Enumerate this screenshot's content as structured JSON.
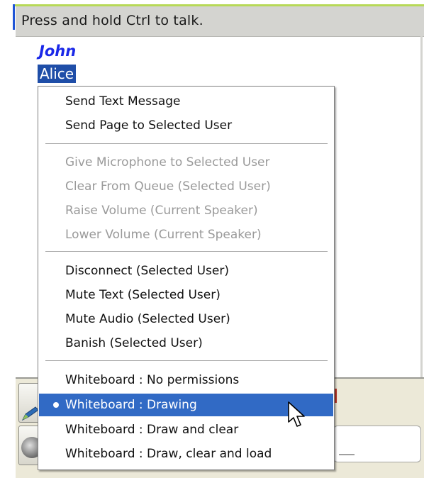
{
  "header": {
    "hint": "Press and hold Ctrl to talk."
  },
  "users": [
    {
      "name": "John",
      "style": "bold-italic-blue"
    },
    {
      "name": "Alice",
      "selected": true
    }
  ],
  "context_menu": {
    "groups": [
      [
        {
          "label": "Send Text Message",
          "enabled": true
        },
        {
          "label": "Send Page to Selected User",
          "enabled": true
        }
      ],
      [
        {
          "label": "Give Microphone to Selected User",
          "enabled": false
        },
        {
          "label": "Clear From Queue (Selected User)",
          "enabled": false
        },
        {
          "label": "Raise Volume (Current Speaker)",
          "enabled": false
        },
        {
          "label": "Lower Volume (Current Speaker)",
          "enabled": false
        }
      ],
      [
        {
          "label": "Disconnect (Selected User)",
          "enabled": true
        },
        {
          "label": "Mute Text (Selected User)",
          "enabled": true
        },
        {
          "label": "Mute Audio (Selected User)",
          "enabled": true
        },
        {
          "label": "Banish (Selected User)",
          "enabled": true
        }
      ],
      [
        {
          "label": "Whiteboard : No permissions",
          "enabled": true
        },
        {
          "label": "Whiteboard : Drawing",
          "enabled": true,
          "checked": true,
          "highlighted": true
        },
        {
          "label": "Whiteboard : Draw and clear",
          "enabled": true
        },
        {
          "label": "Whiteboard : Draw, clear and load",
          "enabled": true
        }
      ]
    ]
  },
  "toolbar": {
    "icons": [
      "pen-icon",
      "speaker-icon"
    ]
  },
  "colors": {
    "header_bg": "#d4d4d0",
    "john": "#1a28e8",
    "selection": "#1f4ea8",
    "menu_highlight": "#316ac5",
    "disabled_text": "#9a9a9a"
  }
}
